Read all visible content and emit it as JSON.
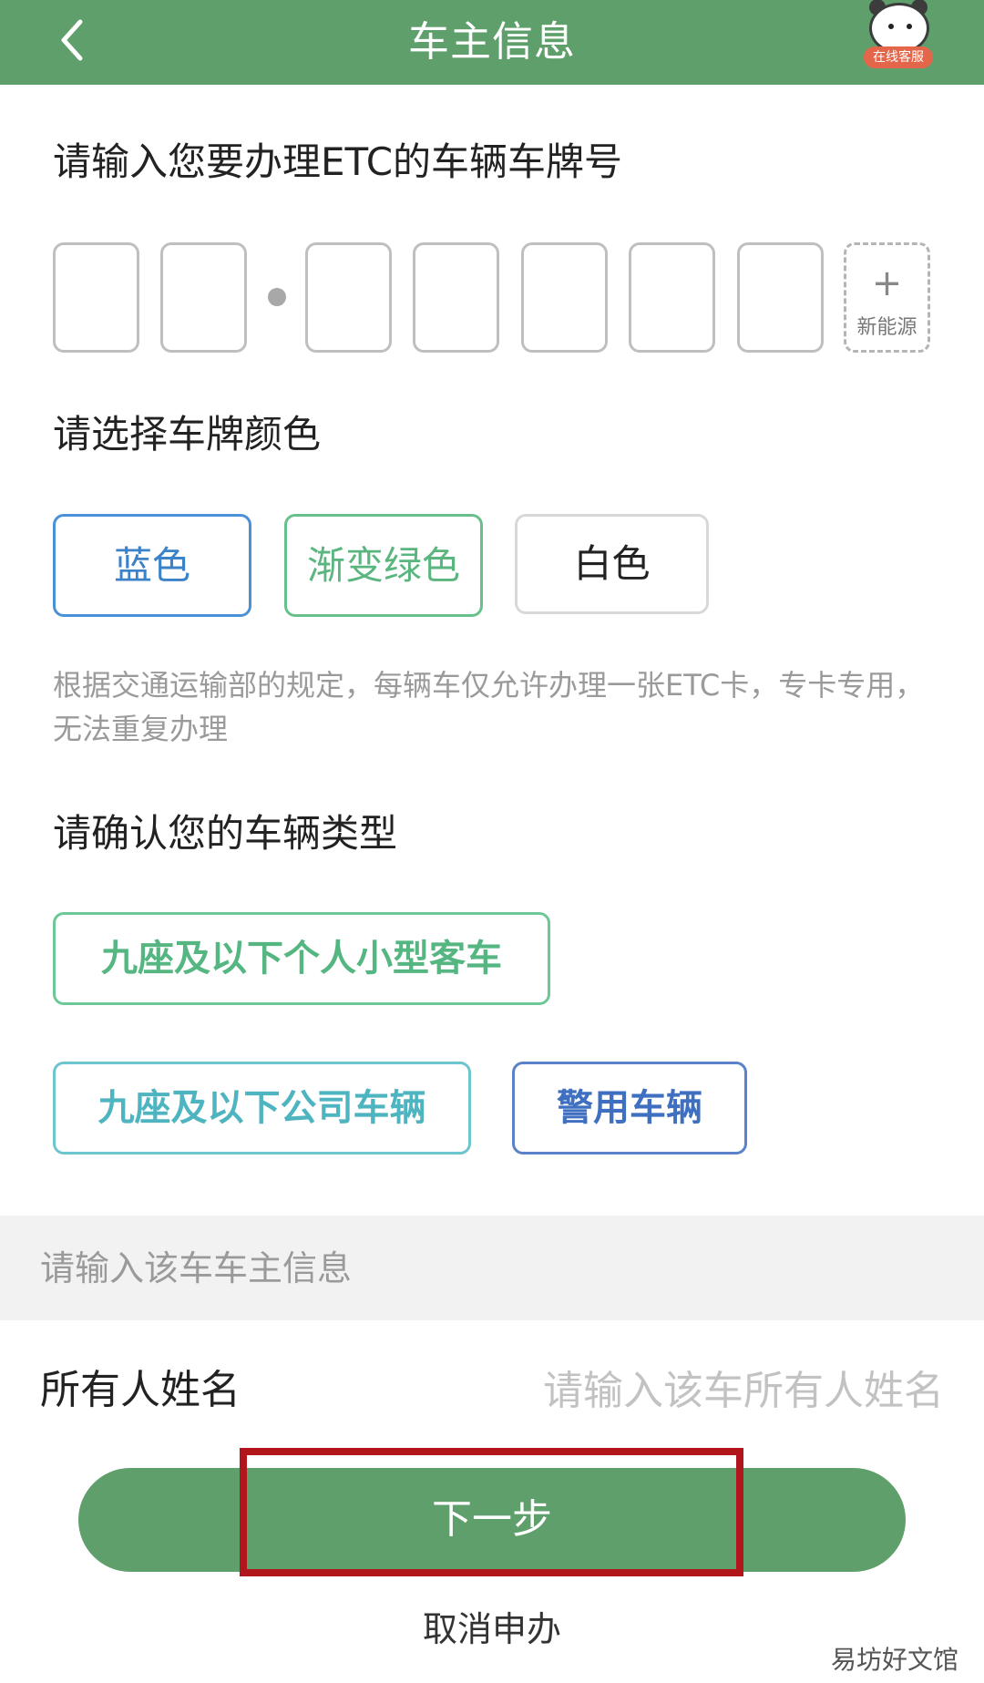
{
  "header": {
    "title": "车主信息",
    "customer_service_label": "在线客服"
  },
  "plate": {
    "prompt": "请输入您要办理ETC的车辆车牌号",
    "new_energy_label": "新能源",
    "new_energy_icon": "+"
  },
  "plate_color": {
    "prompt": "请选择车牌颜色",
    "options": [
      "蓝色",
      "渐变绿色",
      "白色"
    ]
  },
  "notice": "根据交通运输部的规定，每辆车仅允许办理一张ETC卡，专卡专用，无法重复办理",
  "vehicle_type": {
    "prompt": "请确认您的车辆类型",
    "options": [
      "九座及以下个人小型客车",
      "九座及以下公司车辆",
      "警用车辆"
    ]
  },
  "owner": {
    "section_title": "请输入该车车主信息",
    "name_label": "所有人姓名",
    "name_placeholder": "请输入该车所有人姓名",
    "name_value": ""
  },
  "actions": {
    "next_label": "下一步",
    "cancel_label": "取消申办"
  },
  "watermark": "易坊好文馆",
  "colors": {
    "brand_green": "#5f9f6b",
    "blue": "#4a90d8",
    "gradient_green": "#68c08c",
    "highlight_red": "#b0161b"
  }
}
